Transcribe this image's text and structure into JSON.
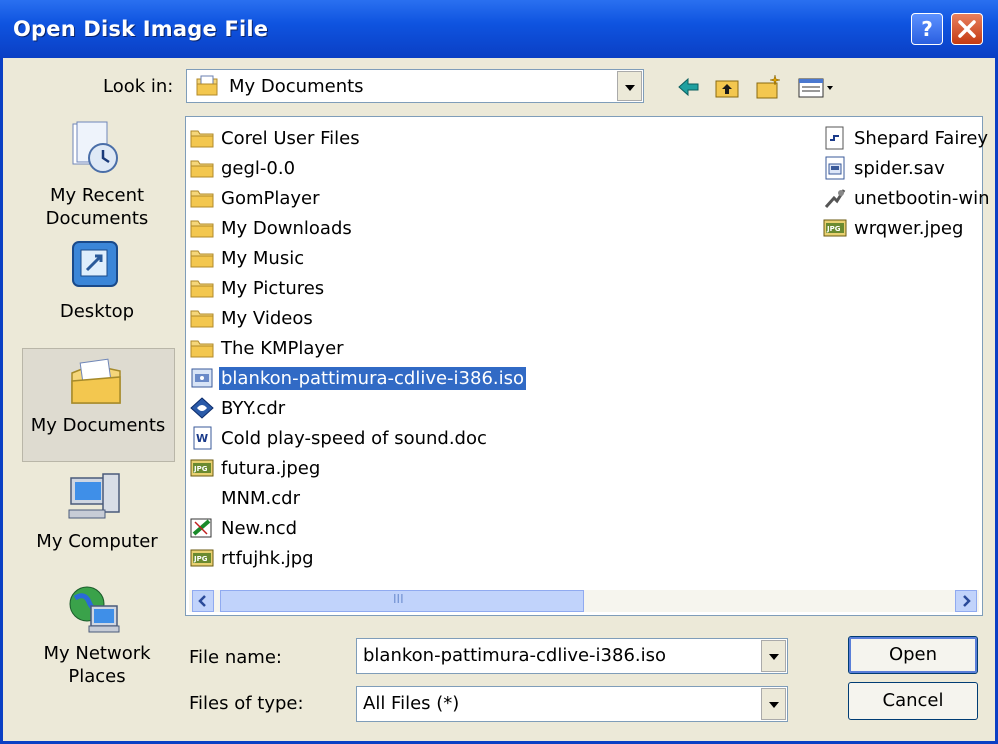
{
  "window": {
    "title": "Open Disk Image File",
    "help_label": "?",
    "close_label": "✕"
  },
  "look_in": {
    "label": "Look in:",
    "value": "My Documents"
  },
  "toolbar": {
    "icons": [
      "back-icon",
      "up-folder-icon",
      "new-folder-icon",
      "view-menu-icon"
    ]
  },
  "places": [
    {
      "label": "My Recent Documents",
      "icon": "recent-documents-icon"
    },
    {
      "label": "Desktop",
      "icon": "desktop-icon"
    },
    {
      "label": "My Documents",
      "icon": "my-documents-icon"
    },
    {
      "label": "My Computer",
      "icon": "my-computer-icon"
    },
    {
      "label": "My Network Places",
      "icon": "network-places-icon"
    }
  ],
  "files_col1": [
    {
      "name": "Corel User Files",
      "icon": "folder-icon"
    },
    {
      "name": "gegl-0.0",
      "icon": "folder-icon"
    },
    {
      "name": "GomPlayer",
      "icon": "folder-icon"
    },
    {
      "name": "My Downloads",
      "icon": "folder-icon"
    },
    {
      "name": "My Music",
      "icon": "folder-icon"
    },
    {
      "name": "My Pictures",
      "icon": "folder-icon"
    },
    {
      "name": "My Videos",
      "icon": "folder-icon"
    },
    {
      "name": "The KMPlayer",
      "icon": "folder-icon"
    },
    {
      "name": "blankon-pattimura-cdlive-i386.iso",
      "icon": "disk-image-icon",
      "selected": true
    },
    {
      "name": "BYY.cdr",
      "icon": "coreldraw-icon"
    },
    {
      "name": "Cold play-speed of sound.doc",
      "icon": "word-document-icon"
    },
    {
      "name": "futura.jpeg",
      "icon": "jpeg-icon"
    },
    {
      "name": "MNM.cdr",
      "icon": "blank-file-icon"
    },
    {
      "name": "New.ncd",
      "icon": "nero-icon"
    },
    {
      "name": "rtfujhk.jpg",
      "icon": "jpeg-icon"
    }
  ],
  "files_col2": [
    {
      "name": "Shepard Fairey",
      "icon": "shortcut-icon"
    },
    {
      "name": "spider.sav",
      "icon": "save-file-icon"
    },
    {
      "name": "unetbootin-win",
      "icon": "application-icon"
    },
    {
      "name": "wrqwer.jpeg",
      "icon": "jpeg-icon"
    }
  ],
  "filename": {
    "label": "File name:",
    "value": "blankon-pattimura-cdlive-i386.iso"
  },
  "filetype": {
    "label": "Files of type:",
    "value": "All Files (*)"
  },
  "buttons": {
    "open": "Open",
    "cancel": "Cancel"
  },
  "scrollbar": {
    "grip": "III"
  },
  "colors": {
    "title_bar": "#0a3fc4",
    "selection": "#316ac5",
    "dialog_bg": "#ece9d8"
  }
}
